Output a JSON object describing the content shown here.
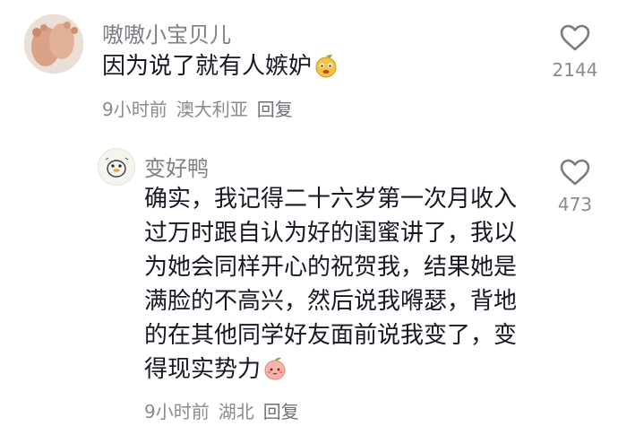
{
  "comments": [
    {
      "username": "嗷嗷小宝贝儿",
      "text": "因为说了就有人嫉妒",
      "emoji": "sour-face-emoji",
      "time": "9小时前",
      "location": "澳大利亚",
      "reply_label": "回复",
      "likes": "2144",
      "avatar": "feet-photo"
    },
    {
      "username": "变好鸭",
      "text": "确实，我记得二十六岁第一次月收入过万时跟自认为好的闺蜜讲了，我以为她会同样开心的祝贺我，结果她是满脸的不高兴，然后说我嘚瑟，背地的在其他同学好友面前说我变了，变得现实势力",
      "emoji": "peach-blush-emoji",
      "time": "9小时前",
      "location": "湖北",
      "reply_label": "回复",
      "likes": "473",
      "avatar": "duck-sketch"
    }
  ],
  "colors": {
    "text": "#161823",
    "secondary": "#8a8b91",
    "username": "#7f7f86"
  },
  "icons": {
    "like": "heart-outline-icon"
  }
}
